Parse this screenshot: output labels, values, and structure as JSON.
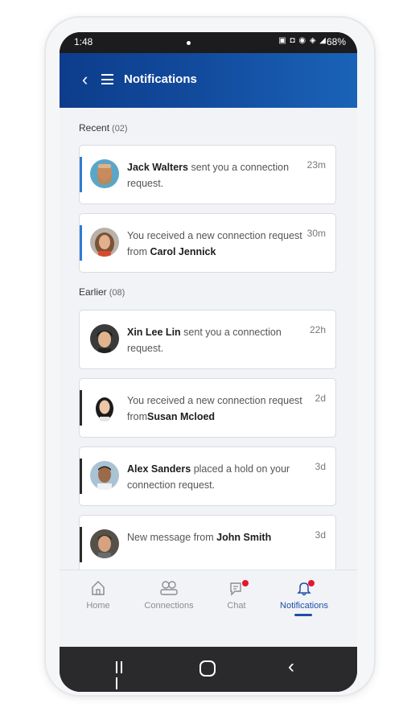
{
  "status_bar": {
    "time": "1:48",
    "icons": "▣ ◘ ◉ ◈ ◢",
    "battery": "68%"
  },
  "header": {
    "title": "Notifications",
    "back_icon": "chevron-left-icon",
    "menu_icon": "menu-icon"
  },
  "sections": {
    "recent": {
      "label": "Recent",
      "count": "(02)"
    },
    "earlier": {
      "label": "Earlier",
      "count": "(08)"
    }
  },
  "notifications": [
    {
      "bold_prefix": "Jack Walters",
      "text": " sent you a connection request.",
      "bold_suffix": "",
      "time": "23m"
    },
    {
      "bold_prefix": "",
      "text": "You received a new connection request from ",
      "bold_suffix": "Carol Jennick",
      "time": "30m"
    },
    {
      "bold_prefix": "Xin Lee Lin",
      "text": " sent you a connection request.",
      "bold_suffix": "",
      "time": "22h"
    },
    {
      "bold_prefix": "",
      "text": "You received a new connection request from",
      "bold_suffix": "Susan Mcloed",
      "time": "2d"
    },
    {
      "bold_prefix": "Alex Sanders",
      "text": " placed a hold on your connection request.",
      "bold_suffix": "",
      "time": "3d"
    },
    {
      "bold_prefix": "",
      "text": "New message from ",
      "bold_suffix": "John Smith",
      "time": "3d"
    }
  ],
  "tabs": [
    {
      "label": "Home",
      "icon": "home-icon"
    },
    {
      "label": "Connections",
      "icon": "connections-icon"
    },
    {
      "label": "Chat",
      "icon": "chat-icon"
    },
    {
      "label": "Notifications",
      "icon": "bell-icon"
    }
  ],
  "colors": {
    "accent": "#1d4ea6",
    "unread_bar": "#2f7bd6",
    "read_bar": "#2b2b2b",
    "badge": "#e3192e"
  }
}
